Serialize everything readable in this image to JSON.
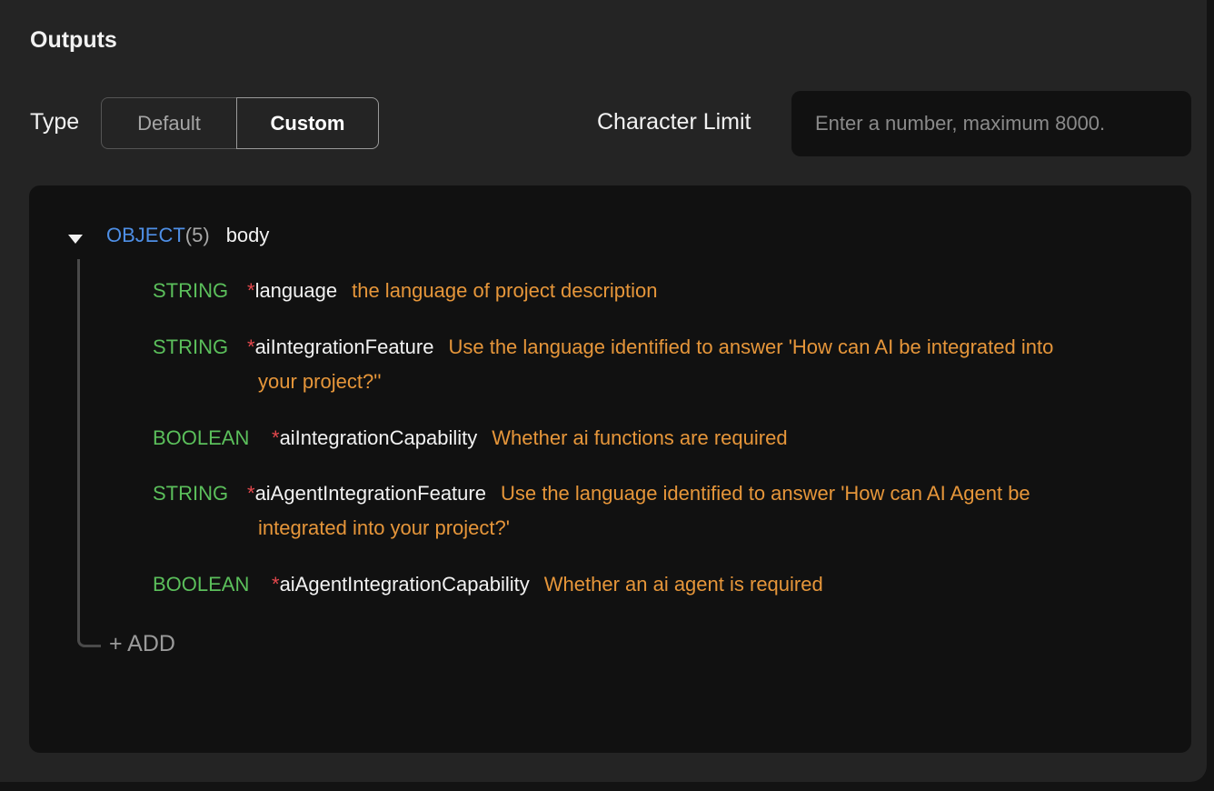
{
  "outputs": {
    "title": "Outputs",
    "type_label": "Type",
    "type_options": [
      "Default",
      "Custom"
    ],
    "type_selected": "Custom",
    "char_limit_label": "Character Limit",
    "char_limit_placeholder": "Enter a number, maximum 8000.",
    "char_limit_value": ""
  },
  "schema": {
    "root": {
      "type": "OBJECT",
      "count": "(5)",
      "name": "body",
      "expanded": true
    },
    "fields": [
      {
        "type": "STRING",
        "required": "*",
        "name": "language",
        "description_line1": "the language of project description",
        "description_line2": ""
      },
      {
        "type": "STRING",
        "required": "*",
        "name": "aiIntegrationFeature",
        "description_line1": "Use the language identified to answer 'How can AI be integrated into",
        "description_line2": "your project?''"
      },
      {
        "type": "BOOLEAN",
        "required": "*",
        "name": "aiIntegrationCapability",
        "description_line1": "Whether ai functions are required",
        "description_line2": ""
      },
      {
        "type": "STRING",
        "required": "*",
        "name": "aiAgentIntegrationFeature",
        "description_line1": "Use the language identified to answer 'How can AI Agent be",
        "description_line2": "integrated into your project?'"
      },
      {
        "type": "BOOLEAN",
        "required": "*",
        "name": "aiAgentIntegrationCapability",
        "description_line1": "Whether an ai agent is required",
        "description_line2": ""
      }
    ],
    "add_label": "+ ADD"
  },
  "colors": {
    "object_keyword": "#4e8fe6",
    "type_keyword": "#5bbf5b",
    "required_marker": "#e5484d",
    "description": "#e6963a"
  }
}
